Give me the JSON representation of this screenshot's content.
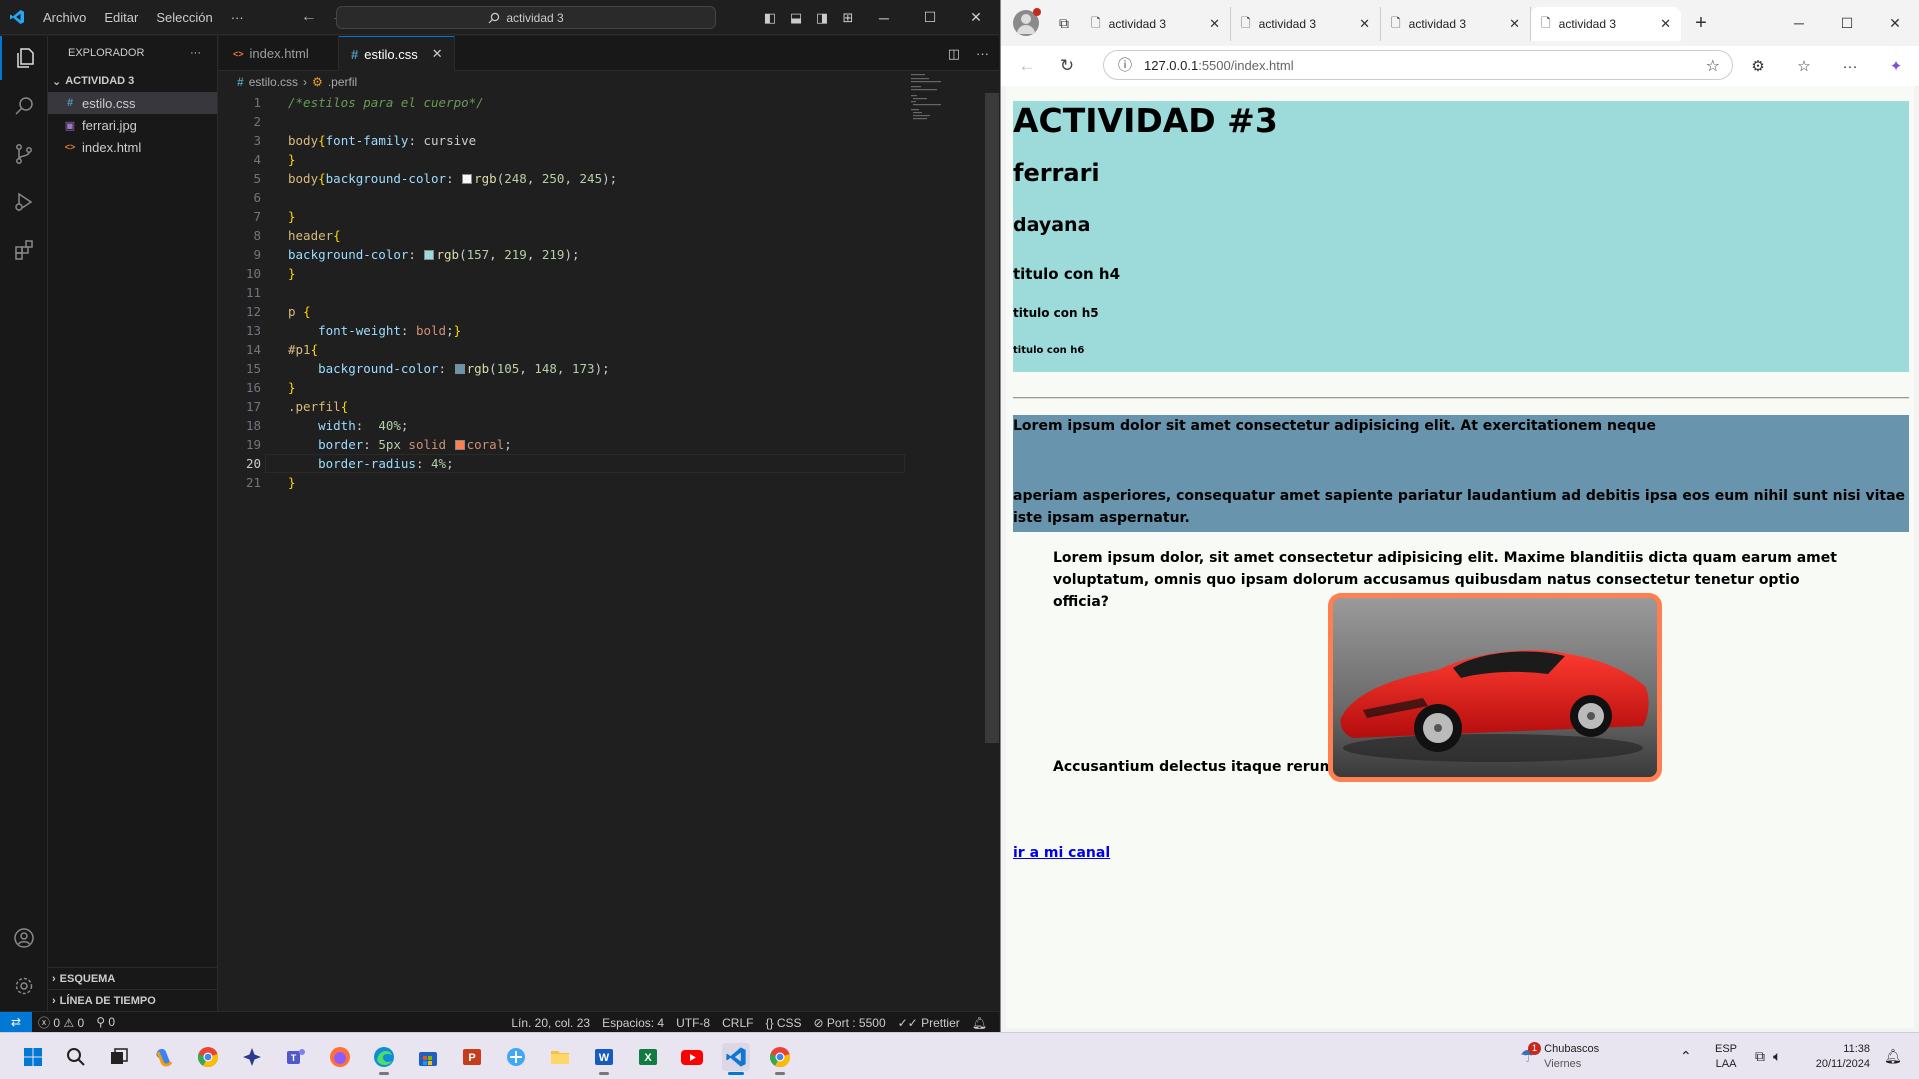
{
  "vscode": {
    "menu": [
      "Archivo",
      "Editar",
      "Selección",
      "···"
    ],
    "command_center": "actividad 3",
    "explorer_title": "EXPLORADOR",
    "folder": "ACTIVIDAD 3",
    "files": [
      {
        "name": "estilo.css",
        "icon": "#",
        "selected": true
      },
      {
        "name": "ferrari.jpg",
        "icon": "▣",
        "selected": false
      },
      {
        "name": "index.html",
        "icon": "<>",
        "selected": false
      }
    ],
    "outline": "ESQUEMA",
    "timeline": "LÍNEA DE TIEMPO",
    "tabs": [
      {
        "label": "index.html",
        "icon": "<>",
        "active": false
      },
      {
        "label": "estilo.css",
        "icon": "#",
        "active": true
      }
    ],
    "breadcrumb": {
      "file": "estilo.css",
      "symbol": ".perfil"
    },
    "current_line": 20,
    "code_lines": [
      [
        {
          "c": "c-com",
          "t": "/*estilos para el cuerpo*/"
        }
      ],
      [],
      [
        {
          "c": "c-sel",
          "t": "body"
        },
        {
          "c": "c-br",
          "t": "{"
        },
        {
          "c": "c-prop",
          "t": "font-family"
        },
        {
          "c": "c-pl",
          "t": ": "
        },
        {
          "c": "c-pl",
          "t": "cursive"
        }
      ],
      [
        {
          "c": "c-br",
          "t": "}"
        }
      ],
      [
        {
          "c": "c-sel",
          "t": "body"
        },
        {
          "c": "c-br",
          "t": "{"
        },
        {
          "c": "c-prop",
          "t": "background-color"
        },
        {
          "c": "c-pl",
          "t": ": "
        },
        {
          "sw": "rgb(248,250,245)"
        },
        {
          "c": "c-fn",
          "t": "rgb"
        },
        {
          "c": "c-pl",
          "t": "("
        },
        {
          "c": "c-num",
          "t": "248"
        },
        {
          "c": "c-pl",
          "t": ", "
        },
        {
          "c": "c-num",
          "t": "250"
        },
        {
          "c": "c-pl",
          "t": ", "
        },
        {
          "c": "c-num",
          "t": "245"
        },
        {
          "c": "c-pl",
          "t": ");"
        }
      ],
      [],
      [
        {
          "c": "c-br",
          "t": "}"
        }
      ],
      [
        {
          "c": "c-sel",
          "t": "header"
        },
        {
          "c": "c-br",
          "t": "{"
        }
      ],
      [
        {
          "c": "c-prop",
          "t": "background-color"
        },
        {
          "c": "c-pl",
          "t": ": "
        },
        {
          "sw": "rgb(157,219,219)"
        },
        {
          "c": "c-fn",
          "t": "rgb"
        },
        {
          "c": "c-pl",
          "t": "("
        },
        {
          "c": "c-num",
          "t": "157"
        },
        {
          "c": "c-pl",
          "t": ", "
        },
        {
          "c": "c-num",
          "t": "219"
        },
        {
          "c": "c-pl",
          "t": ", "
        },
        {
          "c": "c-num",
          "t": "219"
        },
        {
          "c": "c-pl",
          "t": ");"
        }
      ],
      [
        {
          "c": "c-br",
          "t": "}"
        }
      ],
      [],
      [
        {
          "c": "c-sel",
          "t": "p "
        },
        {
          "c": "c-br",
          "t": "{"
        }
      ],
      [
        {
          "c": "c-pl",
          "t": "    "
        },
        {
          "c": "c-prop",
          "t": "font-weight"
        },
        {
          "c": "c-pl",
          "t": ": "
        },
        {
          "c": "c-val",
          "t": "bold"
        },
        {
          "c": "c-pl",
          "t": ";"
        },
        {
          "c": "c-br",
          "t": "}"
        }
      ],
      [
        {
          "c": "c-sel",
          "t": "#p1"
        },
        {
          "c": "c-br",
          "t": "{"
        }
      ],
      [
        {
          "c": "c-pl",
          "t": "    "
        },
        {
          "c": "c-prop",
          "t": "background-color"
        },
        {
          "c": "c-pl",
          "t": ": "
        },
        {
          "sw": "rgb(105,148,173)"
        },
        {
          "c": "c-fn",
          "t": "rgb"
        },
        {
          "c": "c-pl",
          "t": "("
        },
        {
          "c": "c-num",
          "t": "105"
        },
        {
          "c": "c-pl",
          "t": ", "
        },
        {
          "c": "c-num",
          "t": "148"
        },
        {
          "c": "c-pl",
          "t": ", "
        },
        {
          "c": "c-num",
          "t": "173"
        },
        {
          "c": "c-pl",
          "t": ");"
        }
      ],
      [
        {
          "c": "c-br",
          "t": "}"
        }
      ],
      [
        {
          "c": "c-sel",
          "t": ".perfil"
        },
        {
          "c": "c-br",
          "t": "{"
        }
      ],
      [
        {
          "c": "c-pl",
          "t": "    "
        },
        {
          "c": "c-prop",
          "t": "width"
        },
        {
          "c": "c-pl",
          "t": ":  "
        },
        {
          "c": "c-num",
          "t": "40%"
        },
        {
          "c": "c-pl",
          "t": ";"
        }
      ],
      [
        {
          "c": "c-pl",
          "t": "    "
        },
        {
          "c": "c-prop",
          "t": "border"
        },
        {
          "c": "c-pl",
          "t": ": "
        },
        {
          "c": "c-num",
          "t": "5px"
        },
        {
          "c": "c-val",
          "t": " solid "
        },
        {
          "sw": "coral"
        },
        {
          "c": "c-val",
          "t": "coral"
        },
        {
          "c": "c-pl",
          "t": ";"
        }
      ],
      [
        {
          "c": "c-pl",
          "t": "    "
        },
        {
          "c": "c-prop",
          "t": "border-radius"
        },
        {
          "c": "c-pl",
          "t": ": "
        },
        {
          "c": "c-num",
          "t": "4%"
        },
        {
          "c": "c-pl",
          "t": ";"
        }
      ],
      [
        {
          "c": "c-br",
          "t": "}"
        }
      ]
    ],
    "status": {
      "errors": "0",
      "warnings": "0",
      "ports": "0",
      "position": "Lín. 20, col. 23",
      "spaces": "Espacios: 4",
      "encoding": "UTF-8",
      "eol": "CRLF",
      "language": "CSS",
      "port": "Port : 5500",
      "formatter": "Prettier"
    }
  },
  "browser": {
    "tabs": [
      "actividad 3",
      "actividad 3",
      "actividad 3",
      "actividad 3"
    ],
    "active_tab": 3,
    "url_host": "127.0.0.1",
    "url_rest": ":5500/index.html",
    "page": {
      "h1": "ACTIVIDAD #3",
      "h2": "ferrari",
      "h3": "dayana",
      "h4": "titulo con h4",
      "h5": "titulo con h5",
      "h6": "titulo con h6",
      "p1_line1": "Lorem ipsum dolor sit amet consectetur adipisicing elit. At exercitationem neque",
      "p1_line2": "aperiam asperiores, consequatur amet sapiente pariatur laudantium ad debitis ipsa eos eum nihil sunt nisi vitae iste ipsam aspernatur.",
      "p2": "Lorem ipsum dolor, sit amet consectetur adipisicing elit. Maxime blanditiis dicta quam earum amet voluptatum, omnis quo ipsam dolorum accusamus quibusdam natus consectetur tenetur optio officia?",
      "p3": "Accusantium delectus itaque rerum?",
      "link": "ir a mi canal"
    }
  },
  "taskbar": {
    "weather_badge": "1",
    "weather_title": "Chubascos",
    "weather_sub": "Viernes",
    "lang_top": "ESP",
    "lang_bottom": "LAA",
    "time": "11:38",
    "date": "20/11/2024"
  },
  "colors": {
    "vscode_accent": "#0078d4",
    "header_bg": "rgb(157,219,219)",
    "p1_bg": "rgb(105,148,173)",
    "body_bg": "rgb(248,250,245)",
    "perfil_border": "coral"
  }
}
